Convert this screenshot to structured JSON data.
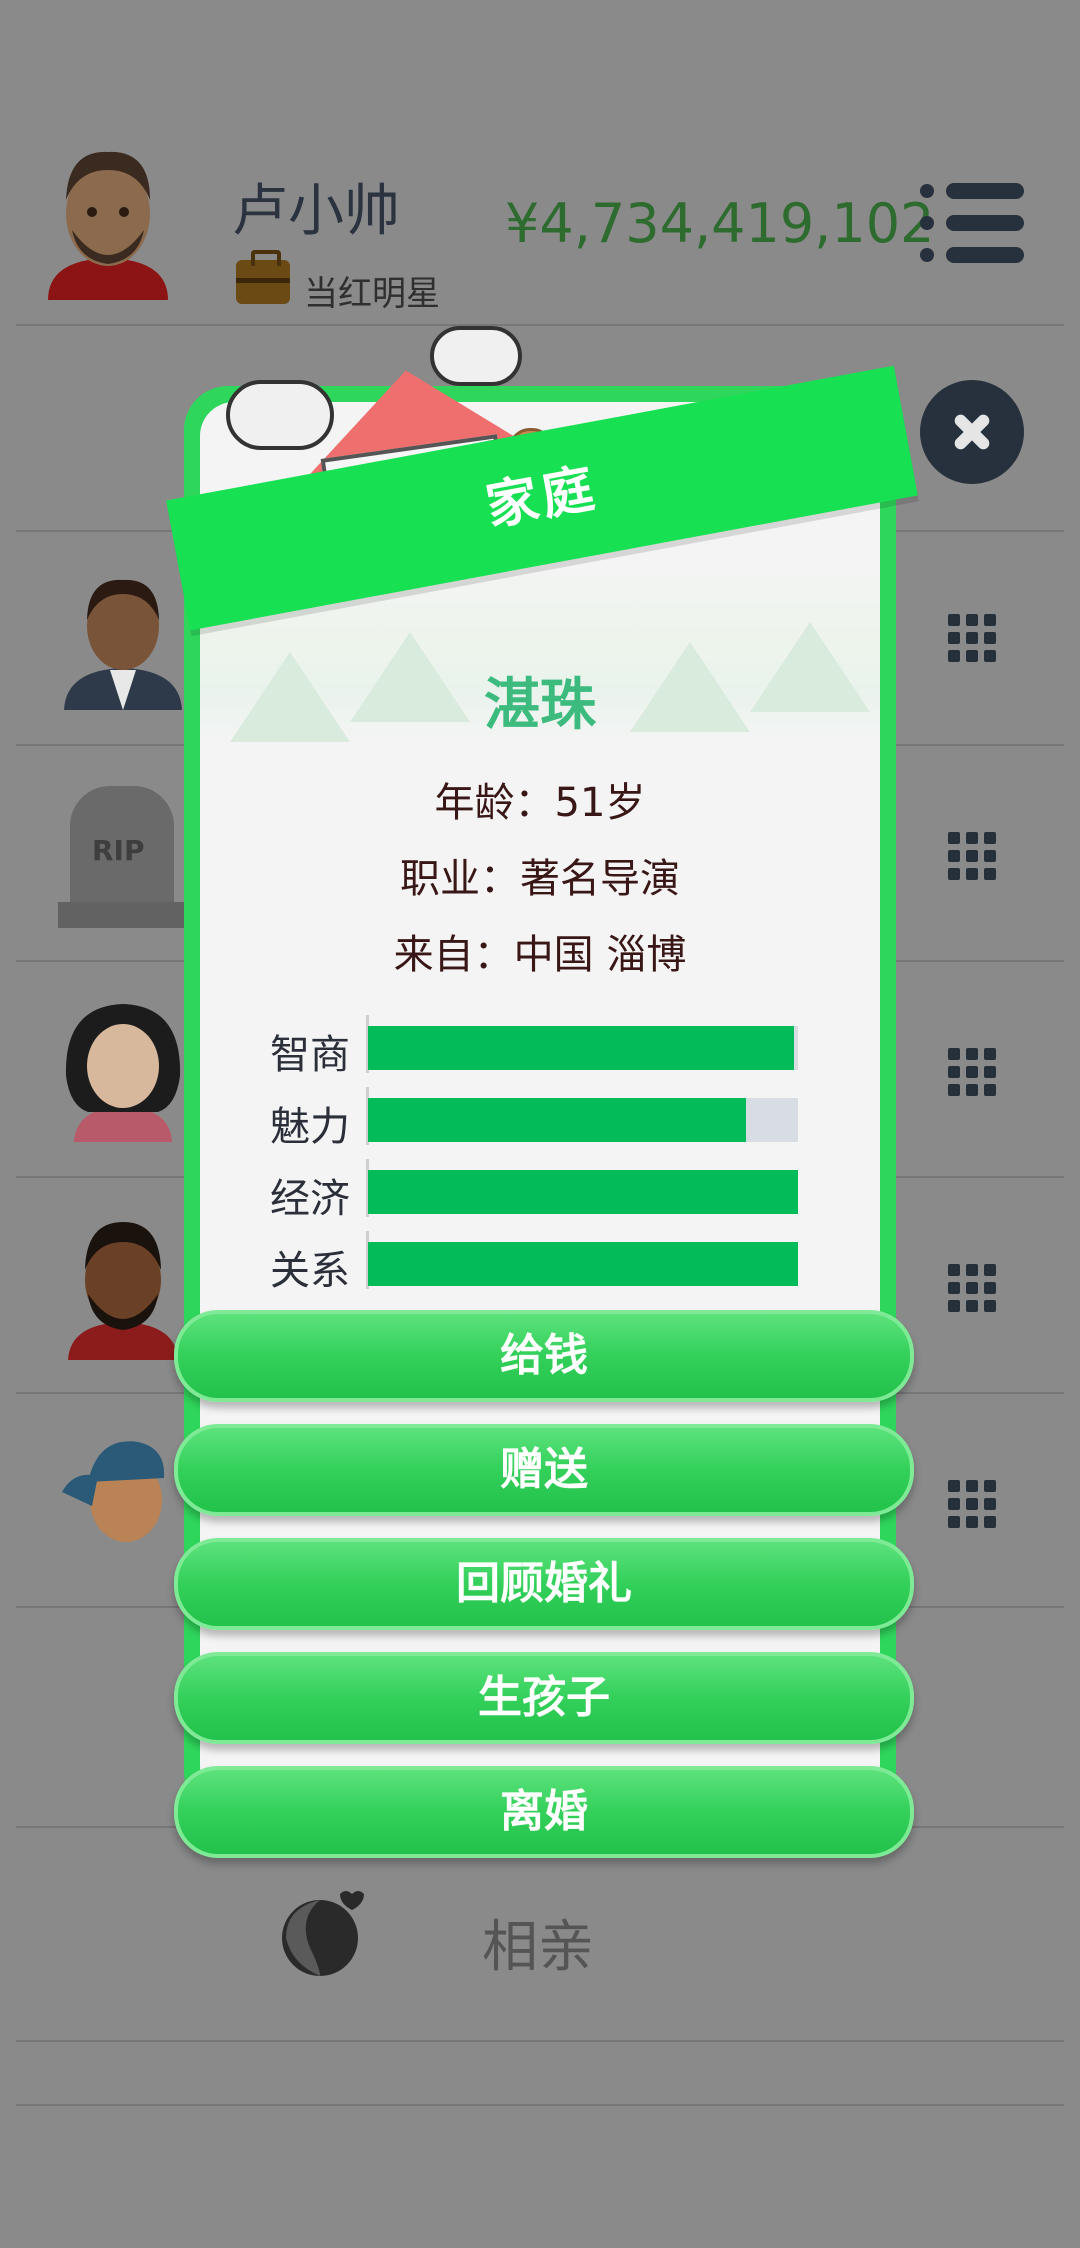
{
  "header": {
    "player_name": "卢小帅",
    "job": "当红明星",
    "money": "¥4,734,419,102"
  },
  "list": {
    "dating_label": "相亲",
    "rip_text": "RIP"
  },
  "modal": {
    "title": "家庭",
    "person_name": "湛珠",
    "age_line": "年龄：51岁",
    "job_line": "职业：著名导演",
    "from_line": "来自：中国 淄博",
    "stats": [
      {
        "label": "智商",
        "value": 0.99
      },
      {
        "label": "魅力",
        "value": 0.88
      },
      {
        "label": "经济",
        "value": 1.0
      },
      {
        "label": "关系",
        "value": 1.0
      }
    ],
    "actions": [
      "给钱",
      "赠送",
      "回顾婚礼",
      "生孩子",
      "离婚"
    ]
  },
  "colors": {
    "accent_green": "#18e053",
    "stat_fill": "#04bb5a",
    "name_green": "#3dbb7f",
    "money_green": "#2e6b2e"
  }
}
